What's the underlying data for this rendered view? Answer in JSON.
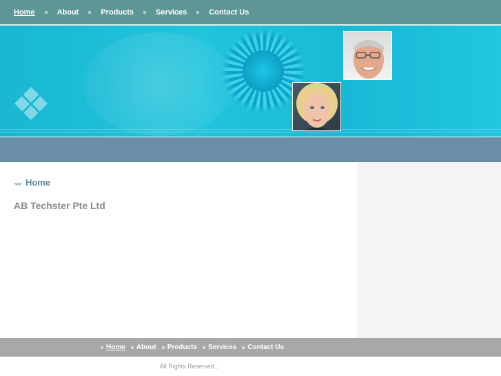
{
  "top_nav": {
    "items": [
      {
        "label": "Home",
        "active": true
      },
      {
        "label": "About",
        "active": false
      },
      {
        "label": "Products",
        "active": false
      },
      {
        "label": "Services",
        "active": false
      },
      {
        "label": "Contact Us",
        "active": false
      }
    ]
  },
  "breadcrumb": {
    "label": "Home",
    "icon": "double-chevron-down-icon"
  },
  "page": {
    "company_name": "AB Techster Pte Ltd"
  },
  "footer_nav": {
    "items": [
      {
        "label": "Home",
        "active": true
      },
      {
        "label": "About",
        "active": false
      },
      {
        "label": "Products",
        "active": false
      },
      {
        "label": "Services",
        "active": false
      },
      {
        "label": "Contact Us",
        "active": false
      }
    ]
  },
  "footer": {
    "copyright": "All Rights Reserved..."
  },
  "colors": {
    "top_nav_bg": "#5e9696",
    "banner_bg": "#1fc0da",
    "subbar_bg": "#6a8ea5",
    "footer_nav_bg": "#a8a8a8",
    "breadcrumb_text": "#5b8aa6",
    "company_text": "#8a8a8a"
  }
}
